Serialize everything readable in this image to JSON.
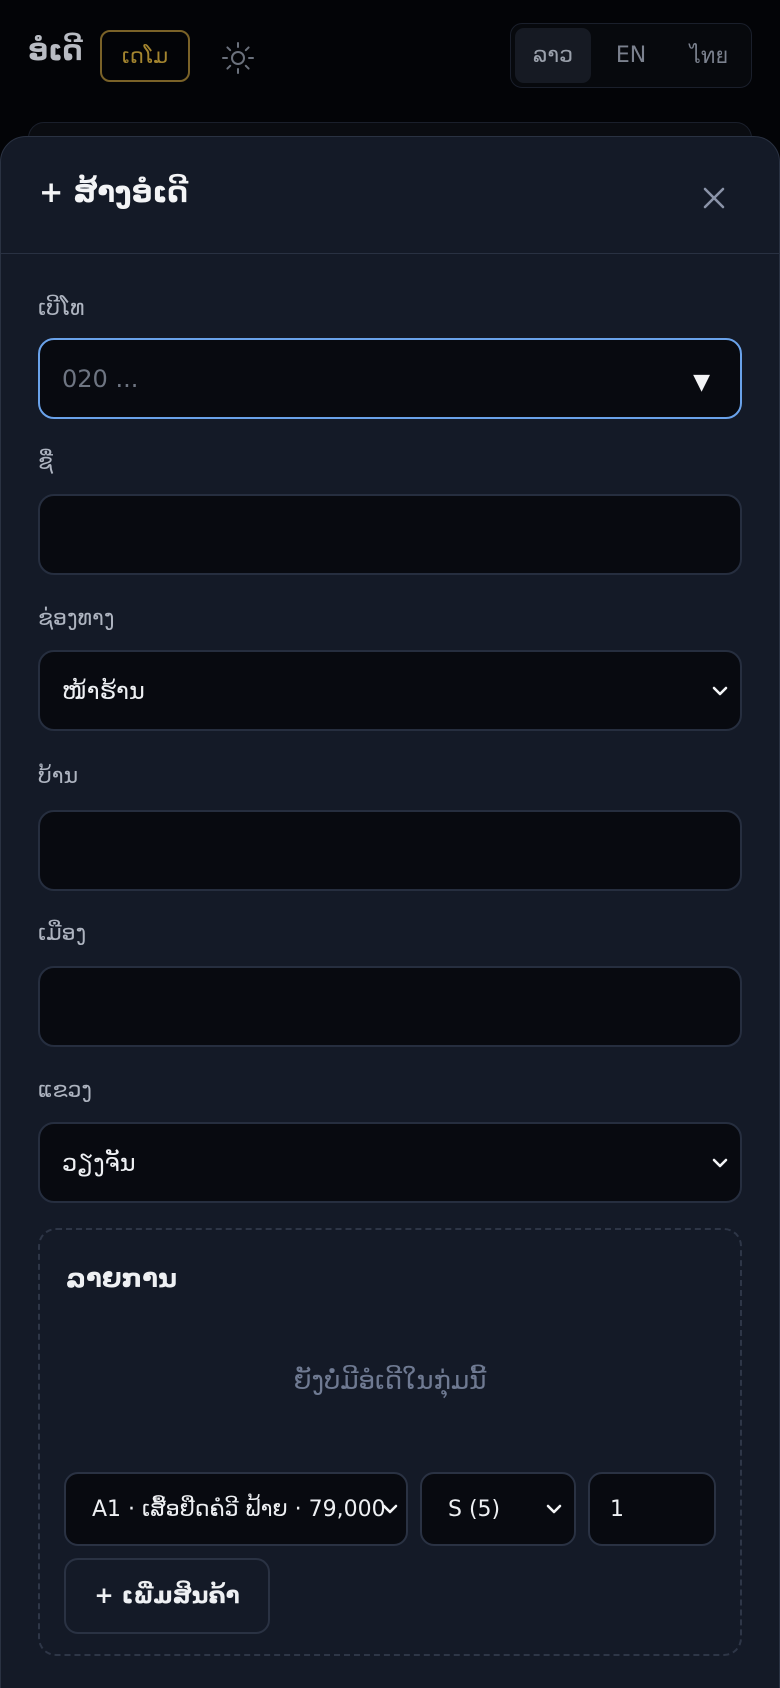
{
  "header": {
    "brand": "ອໍເດີ",
    "demo_badge": "ເດໂມ",
    "languages": [
      "ລາວ",
      "EN",
      "ไทย"
    ],
    "active_language": "ລາວ"
  },
  "modal": {
    "title": "+ ສ້າງອໍເດີ",
    "fields": {
      "phone": {
        "label": "ເບີໂທ",
        "placeholder": "020 ..."
      },
      "name": {
        "label": "ຊື່",
        "value": ""
      },
      "channel": {
        "label": "ຊ່ອງທາງ",
        "value": "ໜ້າຮ້ານ"
      },
      "village": {
        "label": "ບ້ານ",
        "value": ""
      },
      "district": {
        "label": "ເມືອງ",
        "value": ""
      },
      "province": {
        "label": "ແຂວງ",
        "value": "ວຽງຈັນ"
      }
    },
    "items": {
      "title": "ລາຍການ",
      "empty_text": "ຍັງບໍ່ມີອໍເດີໃນກຸ່ມນີ້",
      "product_select": "A1 · ເສື້ອຢືດຄໍວີ ຟ້າຍ · 79,000",
      "size_select": "S (5)",
      "quantity": "1",
      "add_button": "+ ເພີ່ມສິນຄ້າ"
    }
  },
  "colors": {
    "focus_border": "#6aa2ea",
    "demo_badge": "#a4852f",
    "sheet_bg": "#141a27"
  }
}
